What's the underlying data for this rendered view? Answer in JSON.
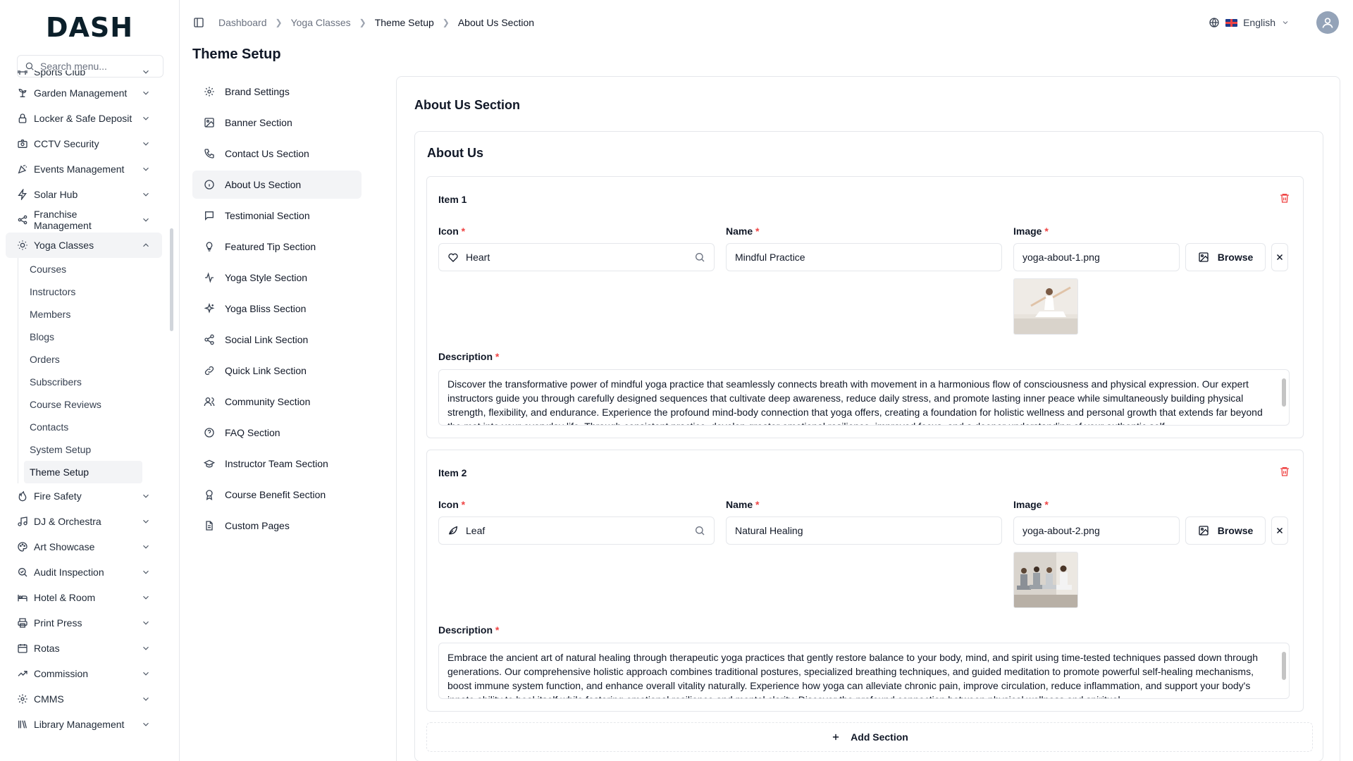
{
  "app": {
    "logo": "DASH"
  },
  "sidebar": {
    "search_placeholder": "Search menu...",
    "items": [
      {
        "label": "Sports Club",
        "icon": "dumbbell-icon"
      },
      {
        "label": "Garden Management",
        "icon": "sprout-icon"
      },
      {
        "label": "Locker & Safe Deposit",
        "icon": "lock-icon"
      },
      {
        "label": "CCTV Security",
        "icon": "camera-icon"
      },
      {
        "label": "Events Management",
        "icon": "party-icon"
      },
      {
        "label": "Solar Hub",
        "icon": "bolt-icon"
      },
      {
        "label": "Franchise Management",
        "icon": "network-icon"
      },
      {
        "label": "Yoga Classes",
        "icon": "sun-icon"
      },
      {
        "label": "Fire Safety",
        "icon": "flame-icon"
      },
      {
        "label": "DJ & Orchestra",
        "icon": "music-icon"
      },
      {
        "label": "Art Showcase",
        "icon": "palette-icon"
      },
      {
        "label": "Audit Inspection",
        "icon": "search-check-icon"
      },
      {
        "label": "Hotel & Room",
        "icon": "bed-icon"
      },
      {
        "label": "Print Press",
        "icon": "printer-icon"
      },
      {
        "label": "Rotas",
        "icon": "calendar-icon"
      },
      {
        "label": "Commission",
        "icon": "trend-icon"
      },
      {
        "label": "CMMS",
        "icon": "gear-icon"
      },
      {
        "label": "Library Management",
        "icon": "library-icon"
      }
    ],
    "yoga_sub": [
      "Courses",
      "Instructors",
      "Members",
      "Blogs",
      "Orders",
      "Subscribers",
      "Course Reviews",
      "Contacts",
      "System Setup",
      "Theme Setup"
    ]
  },
  "breadcrumb": [
    "Dashboard",
    "Yoga Classes",
    "Theme Setup",
    "About Us Section"
  ],
  "topbar": {
    "language": "English"
  },
  "page": {
    "title": "Theme Setup"
  },
  "settings_nav": [
    {
      "label": "Brand Settings",
      "icon": "gear-icon"
    },
    {
      "label": "Banner Section",
      "icon": "image-icon"
    },
    {
      "label": "Contact Us Section",
      "icon": "phone-icon"
    },
    {
      "label": "About Us Section",
      "icon": "info-icon"
    },
    {
      "label": "Testimonial Section",
      "icon": "message-icon"
    },
    {
      "label": "Featured Tip Section",
      "icon": "lightbulb-icon"
    },
    {
      "label": "Yoga Style Section",
      "icon": "activity-icon"
    },
    {
      "label": "Yoga Bliss Section",
      "icon": "sparkles-icon"
    },
    {
      "label": "Social Link Section",
      "icon": "share-icon"
    },
    {
      "label": "Quick Link Section",
      "icon": "link-icon"
    },
    {
      "label": "Community Section",
      "icon": "users-icon"
    },
    {
      "label": "FAQ Section",
      "icon": "help-circle-icon"
    },
    {
      "label": "Instructor Team Section",
      "icon": "graduation-cap-icon"
    },
    {
      "label": "Course Benefit Section",
      "icon": "award-icon"
    },
    {
      "label": "Custom Pages",
      "icon": "file-text-icon"
    }
  ],
  "content": {
    "card_title": "About Us Section",
    "inner_title": "About Us",
    "labels": {
      "icon": "Icon",
      "name": "Name",
      "image": "Image",
      "description": "Description",
      "browse": "Browse",
      "required": "*"
    },
    "items": [
      {
        "title": "Item 1",
        "icon_value": "Heart",
        "name_value": "Mindful Practice",
        "image_value": "yoga-about-1.png",
        "description": "Discover the transformative power of mindful yoga practice that seamlessly connects breath with movement in a harmonious flow of consciousness and physical expression. Our expert instructors guide you through carefully designed sequences that cultivate deep awareness, reduce daily stress, and promote lasting inner peace while simultaneously building physical strength, flexibility, and endurance. Experience the profound mind-body connection that yoga offers, creating a foundation for holistic wellness and personal growth that extends far beyond the mat into your everyday life. Through consistent practice, develop greater emotional resilience, improved focus, and a deeper understanding of your authentic self."
      },
      {
        "title": "Item 2",
        "icon_value": "Leaf",
        "name_value": "Natural Healing",
        "image_value": "yoga-about-2.png",
        "description": "Embrace the ancient art of natural healing through therapeutic yoga practices that gently restore balance to your body, mind, and spirit using time-tested techniques passed down through generations. Our comprehensive holistic approach combines traditional postures, specialized breathing techniques, and guided meditation to promote powerful self-healing mechanisms, boost immune system function, and enhance overall vitality naturally. Experience how yoga can alleviate chronic pain, improve circulation, reduce inflammation, and support your body's innate ability to heal itself while fostering emotional resilience and mental clarity. Discover the profound connection between physical wellness and spiritual"
      }
    ],
    "add_section": "Add Section"
  }
}
